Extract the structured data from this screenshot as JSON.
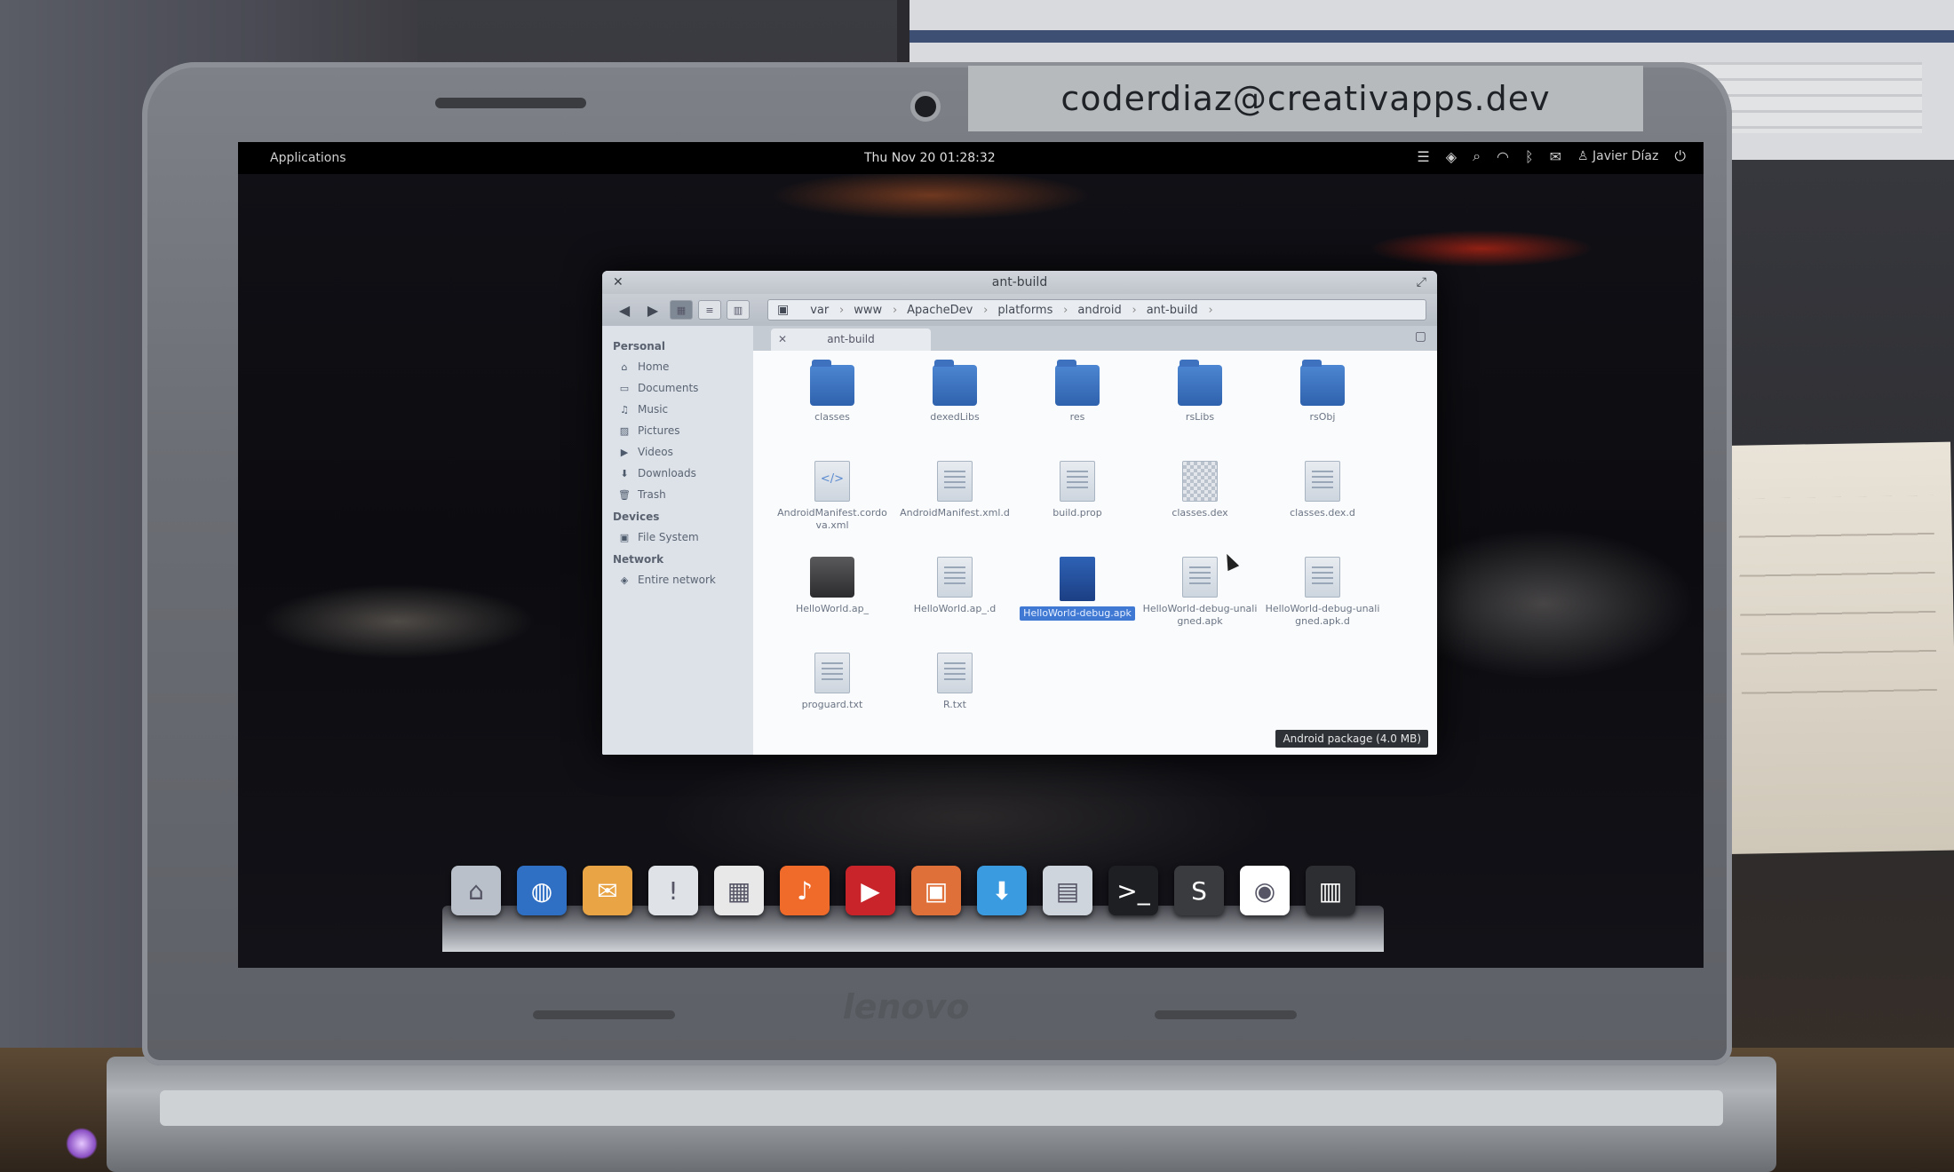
{
  "sticker_text": "coderdiaz@creativapps.dev",
  "laptop_brand": "lenovo",
  "top_panel": {
    "applications": "Applications",
    "clock": "Thu Nov 20 01:28:32",
    "user": "Javier Díaz"
  },
  "window": {
    "title": "ant-build",
    "tab_label": "ant-build",
    "breadcrumb": [
      "var",
      "www",
      "ApacheDev",
      "platforms",
      "android",
      "ant-build"
    ],
    "sidebar": {
      "personal_heading": "Personal",
      "personal_items": [
        {
          "label": "Home",
          "icon": "home-icon"
        },
        {
          "label": "Documents",
          "icon": "document-icon"
        },
        {
          "label": "Music",
          "icon": "music-icon"
        },
        {
          "label": "Pictures",
          "icon": "picture-icon"
        },
        {
          "label": "Videos",
          "icon": "video-icon"
        },
        {
          "label": "Downloads",
          "icon": "download-icon"
        },
        {
          "label": "Trash",
          "icon": "trash-icon"
        }
      ],
      "devices_heading": "Devices",
      "devices_items": [
        {
          "label": "File System",
          "icon": "drive-icon"
        }
      ],
      "network_heading": "Network",
      "network_items": [
        {
          "label": "Entire network",
          "icon": "network-icon"
        }
      ]
    },
    "files": [
      {
        "name": "classes",
        "type": "folder"
      },
      {
        "name": "dexedLibs",
        "type": "folder"
      },
      {
        "name": "res",
        "type": "folder"
      },
      {
        "name": "rsLibs",
        "type": "folder"
      },
      {
        "name": "rsObj",
        "type": "folder"
      },
      {
        "name": "AndroidManifest.cordova.xml",
        "type": "xml"
      },
      {
        "name": "AndroidManifest.xml.d",
        "type": "doc"
      },
      {
        "name": "build.prop",
        "type": "doc"
      },
      {
        "name": "classes.dex",
        "type": "dex"
      },
      {
        "name": "classes.dex.d",
        "type": "doc"
      },
      {
        "name": "HelloWorld.ap_",
        "type": "archive"
      },
      {
        "name": "HelloWorld.ap_.d",
        "type": "doc"
      },
      {
        "name": "HelloWorld-debug.apk",
        "type": "apk",
        "selected": true
      },
      {
        "name": "HelloWorld-debug-unaligned.apk",
        "type": "doc"
      },
      {
        "name": "HelloWorld-debug-unaligned.apk.d",
        "type": "doc"
      },
      {
        "name": "proguard.txt",
        "type": "doc"
      },
      {
        "name": "R.txt",
        "type": "doc"
      }
    ],
    "status": "Android package (4.0 MB)"
  },
  "dock": [
    {
      "icon": "files-icon",
      "color": "#b9c0c9",
      "glyph": "⌂"
    },
    {
      "icon": "browser-globe-icon",
      "color": "#2f6fc4",
      "glyph": "◍"
    },
    {
      "icon": "mail-icon",
      "color": "#e9a545",
      "glyph": "✉"
    },
    {
      "icon": "chat-icon",
      "color": "#dfe3e8",
      "glyph": "!"
    },
    {
      "icon": "calendar-icon",
      "color": "#e8e8e8",
      "glyph": "▦"
    },
    {
      "icon": "music-player-icon",
      "color": "#f06a2a",
      "glyph": "♪"
    },
    {
      "icon": "video-player-icon",
      "color": "#c8242a",
      "glyph": "▶"
    },
    {
      "icon": "photos-icon",
      "color": "#e0703a",
      "glyph": "▣"
    },
    {
      "icon": "app-center-icon",
      "color": "#3a9be0",
      "glyph": "⬇"
    },
    {
      "icon": "settings-icon",
      "color": "#cfd5dc",
      "glyph": "▤"
    },
    {
      "icon": "terminal-icon",
      "color": "#1d1f22",
      "glyph": ">_"
    },
    {
      "icon": "sublime-text-icon",
      "color": "#3a3b3f",
      "glyph": "S"
    },
    {
      "icon": "chrome-icon",
      "color": "#ffffff",
      "glyph": "◉"
    },
    {
      "icon": "archive-manager-icon",
      "color": "#2d2e31",
      "glyph": "▥"
    }
  ]
}
